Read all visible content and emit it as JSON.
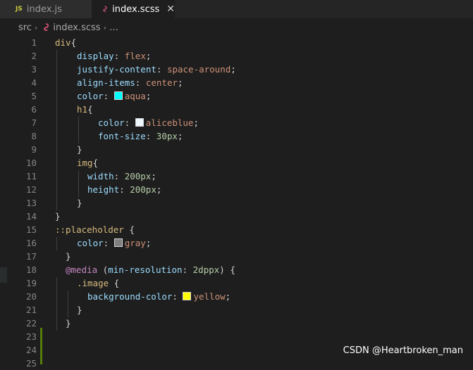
{
  "tabs": [
    {
      "label": "index.js",
      "badge": "JS",
      "active": false
    },
    {
      "label": "index.scss",
      "active": true,
      "close": "✕"
    }
  ],
  "breadcrumb": {
    "folder": "src",
    "file": "index.scss",
    "more": "…",
    "sep": "›"
  },
  "colors": {
    "aqua": "#00ffff",
    "aliceblue": "#f0f8ff",
    "gray": "#808080",
    "yellow": "#ffff00",
    "sass": "#e0577c"
  },
  "lines": [
    {
      "n": "1"
    },
    {
      "n": "2"
    },
    {
      "n": "3"
    },
    {
      "n": "4"
    },
    {
      "n": "5"
    },
    {
      "n": "6"
    },
    {
      "n": "7"
    },
    {
      "n": "8"
    },
    {
      "n": "9"
    },
    {
      "n": "10"
    },
    {
      "n": "11"
    },
    {
      "n": "12"
    },
    {
      "n": "13"
    },
    {
      "n": "14"
    },
    {
      "n": "15"
    },
    {
      "n": "16"
    },
    {
      "n": "17"
    },
    {
      "n": "18"
    },
    {
      "n": "19"
    },
    {
      "n": "20"
    },
    {
      "n": "21"
    },
    {
      "n": "22"
    },
    {
      "n": "23"
    },
    {
      "n": "24"
    },
    {
      "n": "25"
    }
  ],
  "code": {
    "l1_sel": "div",
    "l2_prop": "display",
    "l2_val": "flex",
    "l3_prop": "justify-content",
    "l3_val": "space-around",
    "l4_prop": "align-items",
    "l4_val": "center",
    "l5_prop": "color",
    "l5_val": "aqua",
    "l6_sel": "h1",
    "l7_prop": "color",
    "l7_val": "aliceblue",
    "l8_prop": "font-size",
    "l8_val": "30px",
    "l10_sel": "img",
    "l11_prop": "width",
    "l11_val": "200px",
    "l12_prop": "height",
    "l12_val": "200px",
    "l15_sel": "::placeholder",
    "l16_prop": "color",
    "l16_val": "gray",
    "l18_at": "@media",
    "l18_prop": "min-resolution",
    "l18_val": "2dppx",
    "l19_sel": ".image",
    "l20_prop": "background-color",
    "l20_val": "yellow"
  },
  "watermark": "CSDN @Heartbroken_man"
}
